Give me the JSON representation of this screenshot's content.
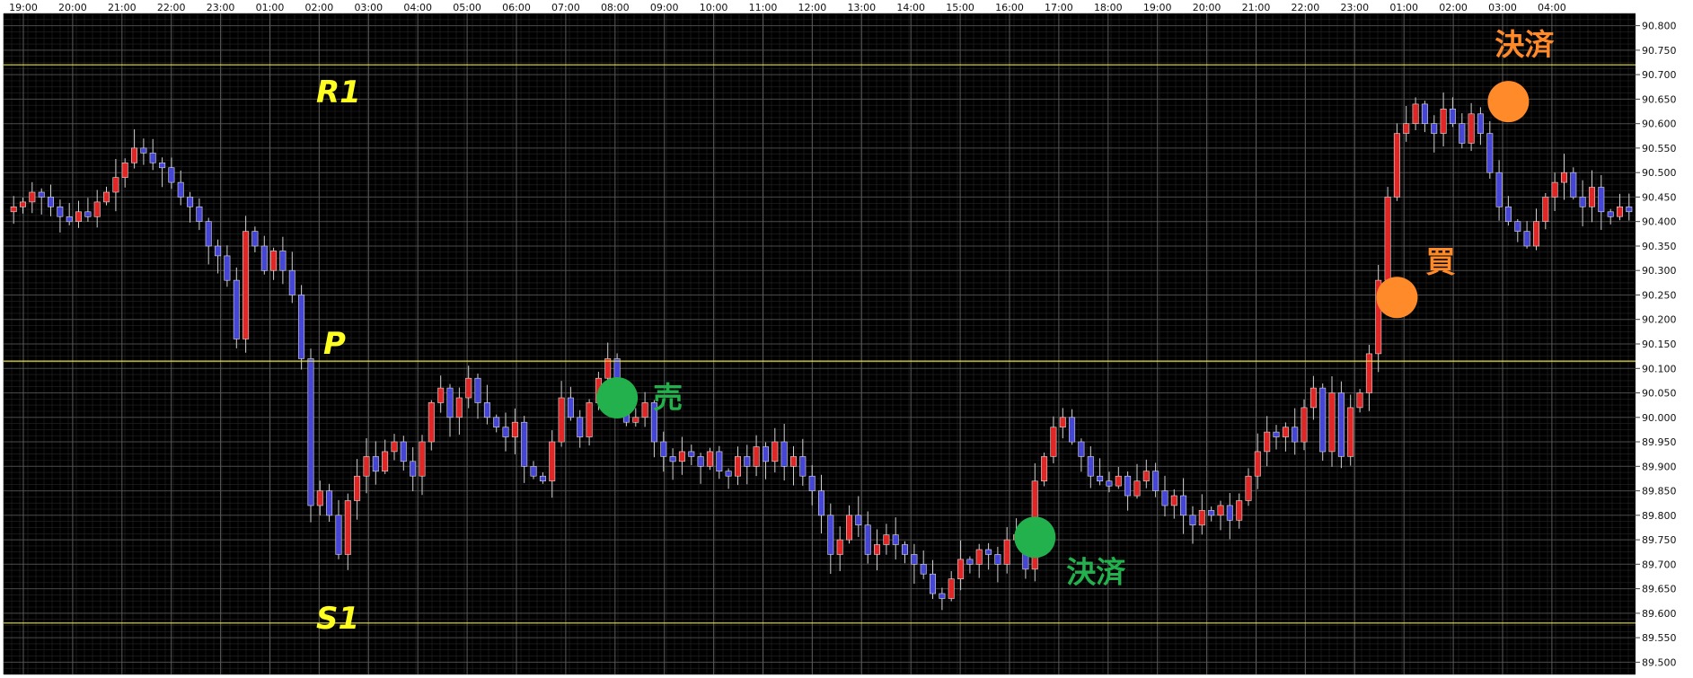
{
  "chart_data": {
    "type": "candlestick",
    "title": "",
    "ylim": [
      89.475,
      90.825
    ],
    "y_ticks": [
      "89.500",
      "89.550",
      "89.600",
      "89.650",
      "89.700",
      "89.750",
      "89.800",
      "89.850",
      "89.900",
      "89.950",
      "90.000",
      "90.050",
      "90.100",
      "90.150",
      "90.200",
      "90.250",
      "90.300",
      "90.350",
      "90.400",
      "90.450",
      "90.500",
      "90.550",
      "90.600",
      "90.650",
      "90.700",
      "90.750",
      "90.800"
    ],
    "x_ticks": [
      "19:00",
      "20:00",
      "21:00",
      "22:00",
      "23:00",
      "01:00",
      "02:00",
      "03:00",
      "04:00",
      "05:00",
      "06:00",
      "07:00",
      "08:00",
      "09:00",
      "10:00",
      "11:00",
      "12:00",
      "13:00",
      "14:00",
      "15:00",
      "16:00",
      "17:00",
      "18:00",
      "19:00",
      "20:00",
      "21:00",
      "22:00",
      "23:00",
      "01:00",
      "02:00",
      "03:00",
      "04:00"
    ],
    "levels": [
      {
        "label": "R1",
        "value": 90.72
      },
      {
        "label": "P",
        "value": 90.115
      },
      {
        "label": "S1",
        "value": 89.58
      }
    ],
    "close_path": [
      90.43,
      90.44,
      90.46,
      90.45,
      90.43,
      90.41,
      90.4,
      90.42,
      90.41,
      90.44,
      90.46,
      90.49,
      90.52,
      90.55,
      90.54,
      90.52,
      90.51,
      90.48,
      90.45,
      90.43,
      90.4,
      90.35,
      90.33,
      90.28,
      90.16,
      90.38,
      90.35,
      90.3,
      90.34,
      90.3,
      90.25,
      90.12,
      89.82,
      89.85,
      89.8,
      89.72,
      89.83,
      89.88,
      89.92,
      89.89,
      89.93,
      89.95,
      89.91,
      89.88,
      89.95,
      90.03,
      90.06,
      90.0,
      90.04,
      90.08,
      90.03,
      90.0,
      89.98,
      89.96,
      89.99,
      89.9,
      89.88,
      89.87,
      89.95,
      90.04,
      90.0,
      89.96,
      90.03,
      90.08,
      90.12,
      90.05,
      89.99,
      90.0,
      90.03,
      89.95,
      89.92,
      89.91,
      89.93,
      89.92,
      89.9,
      89.93,
      89.89,
      89.88,
      89.92,
      89.9,
      89.94,
      89.91,
      89.95,
      89.9,
      89.92,
      89.88,
      89.85,
      89.8,
      89.72,
      89.75,
      89.8,
      89.78,
      89.72,
      89.74,
      89.76,
      89.74,
      89.72,
      89.7,
      89.68,
      89.64,
      89.63,
      89.67,
      89.71,
      89.7,
      89.73,
      89.72,
      89.7,
      89.75,
      89.76,
      89.69,
      89.87,
      89.92,
      89.98,
      90.0,
      89.95,
      89.92,
      89.88,
      89.87,
      89.86,
      89.88,
      89.84,
      89.87,
      89.89,
      89.85,
      89.82,
      89.84,
      89.8,
      89.78,
      89.81,
      89.8,
      89.82,
      89.79,
      89.83,
      89.88,
      89.93,
      89.97,
      89.96,
      89.98,
      89.95,
      90.02,
      90.06,
      89.93,
      90.05,
      89.92,
      90.02,
      90.05,
      90.13,
      90.28,
      90.45,
      90.58,
      90.6,
      90.64,
      90.6,
      90.58,
      90.63,
      90.6,
      90.56,
      90.62,
      90.58,
      90.5,
      90.43,
      90.4,
      90.38,
      90.35,
      90.4,
      90.45,
      90.48,
      90.5,
      90.45,
      90.43,
      90.47,
      90.42,
      90.41,
      90.43,
      90.42
    ],
    "annotations": [
      {
        "label": "売",
        "side": "sell",
        "color": "#22b14c",
        "bar": 65,
        "price": 90.04
      },
      {
        "label": "決済",
        "side": "sell-exit",
        "color": "#22b14c",
        "bar": 110,
        "price": 89.755
      },
      {
        "label": "買",
        "side": "buy",
        "color": "#ff8a2a",
        "bar": 149,
        "price": 90.245
      },
      {
        "label": "決済",
        "side": "buy-exit",
        "color": "#ff8a2a",
        "bar": 161,
        "price": 90.645
      }
    ],
    "colors": {
      "background": "#000000",
      "up": "#e12626",
      "down": "#4545d6",
      "level_line": "#e8e23a",
      "level_label": "#ffff22",
      "grid": "#3a3a3a"
    }
  }
}
